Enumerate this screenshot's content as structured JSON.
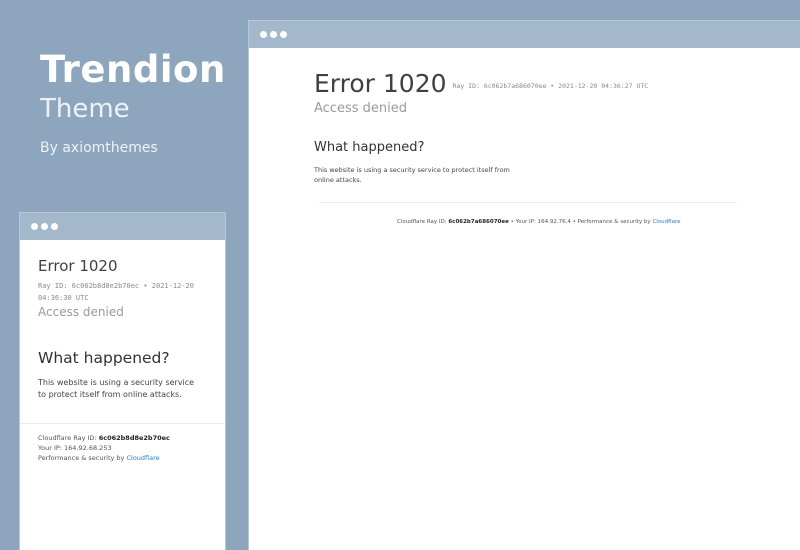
{
  "brand": {
    "name": "Trendion",
    "subtitle": "Theme",
    "by": "By axiomthemes"
  },
  "large_window": {
    "title": "Error 1020",
    "ray_line": "Ray ID: 6c062b7a686070ee • 2021-12-20 04:36:27 UTC",
    "denied": "Access denied",
    "what_happened": "What happened?",
    "body": "This website is using a security service to protect itself from online attacks.",
    "footer": {
      "ray_label": "Cloudflare Ray ID:",
      "ray_id": "6c062b7a686070ee",
      "ip_text": "• Your IP: 164.92.76.4 • Performance & security by",
      "cloudflare_link": "Cloudflare"
    }
  },
  "small_window": {
    "title": "Error 1020",
    "ray_line": "Ray ID: 6c062b8d8e2b70ec • 2021-12-20 04:36:30 UTC",
    "denied": "Access denied",
    "what_happened": "What happened?",
    "body": "This website is using a security service to protect itself from online attacks.",
    "footer": {
      "ray_label": "Cloudflare Ray ID:",
      "ray_id": "6c062b8d8e2b70ec",
      "ip_text": "Your IP: 164.92.68.253",
      "perf_text": "Performance & security by",
      "cloudflare_link": "Cloudflare"
    }
  },
  "colors": {
    "background": "#8ea6bd",
    "titlebar": "#a4b8cb",
    "link": "#2f7bbf"
  }
}
